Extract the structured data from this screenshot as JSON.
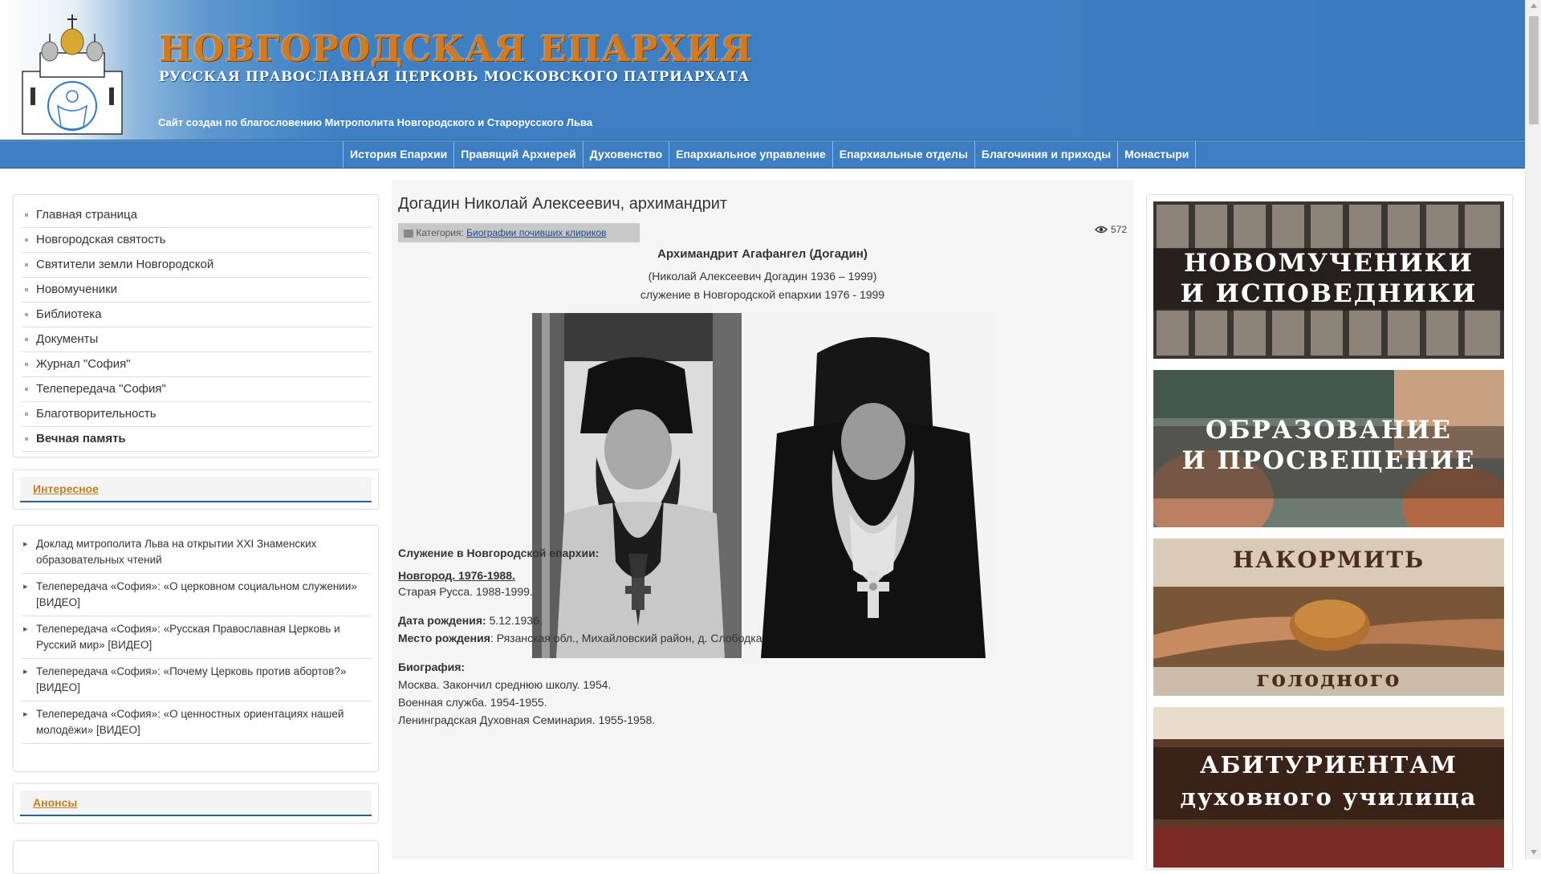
{
  "header": {
    "title": "НОВГОРОДСКАЯ ЕПАРХИЯ",
    "subtitle": "РУССКАЯ ПРАВОСЛАВНАЯ ЦЕРКОВЬ МОСКОВСКОГО ПАТРИАРХАТА",
    "blessing": "Сайт создан по благословению Митрополита Новгородского и Старорусского Льва"
  },
  "nav": {
    "items": [
      "История Епархии",
      "Правящий Архиерей",
      "Духовенство",
      "Епархиальное управление",
      "Епархиальные отделы",
      "Благочиния и приходы",
      "Монастыри"
    ]
  },
  "sidebar": {
    "menu": [
      "Главная страница",
      "Новгородская святость",
      "Святители земли Новгородской",
      "Новомученики",
      "Библиотека",
      "Документы",
      "Журнал \"София\"",
      "Телепередача \"София\"",
      "Благотворительность",
      "Вечная память"
    ],
    "interesting_heading": "Интересное",
    "news": [
      "Доклад митрополита Льва на открытии XXI Знаменских образовательных чтений",
      "Телепередача «София»: «О церковном социальном служении» [ВИДЕО]",
      "Телепередача «София»: «Русская Православная Церковь и Русский мир» [ВИДЕО]",
      "Телепередача «София»: «Почему Церковь против абортов?» [ВИДЕО]",
      "Телепередача «София»: «О ценностных ориентациях нашей молодёжи» [ВИДЕО]"
    ],
    "announcements_heading": "Анонсы"
  },
  "article": {
    "title": "Догадин Николай Алексеевич, архимандрит",
    "category_label": "Категория:",
    "category_link": "Биографии почивших клириков",
    "views": "572",
    "heading": "Архимандрит Агафангел (Догадин)",
    "years": "(Николай Алексеевич Догадин 1936 – 1999)",
    "service_years": "служение в Новгородской епархии 1976 - 1999",
    "service_heading": "Служение в Новгородской епархии:",
    "service_place_1": "Новгород. 1976-1988.",
    "service_place_2": "Старая Русса. 1988-1999.",
    "birth_date_label": "Дата рождения:",
    "birth_date": " 5.12.1936.",
    "birth_place_label": "Место рождения",
    "birth_place": ": Рязанская обл., Михайловский район, д. Слободка.",
    "bio_heading": "Биография:",
    "bio_1": "Москва. Закончил среднюю школу. 1954.",
    "bio_2": "Военная служба. 1954-1955.",
    "bio_3": "Ленинградская Духовная Семинария. 1955-1958."
  },
  "banners": [
    {
      "line1": "НОВОМУЧЕНИКИ",
      "line2": "И ИСПОВЕДНИКИ"
    },
    {
      "line1": "ОБРАЗОВАНИЕ",
      "line2": "И ПРОСВЕЩЕНИЕ"
    },
    {
      "line1": "НАКОРМИТЬ",
      "line2": "голодного"
    },
    {
      "line1": "АБИТУРИЕНТАМ",
      "line2": "духовного училища"
    }
  ],
  "colors": {
    "header_blue": "#3a7cbf",
    "title_orange": "#d47a1e",
    "heading_gold": "#c08020"
  }
}
